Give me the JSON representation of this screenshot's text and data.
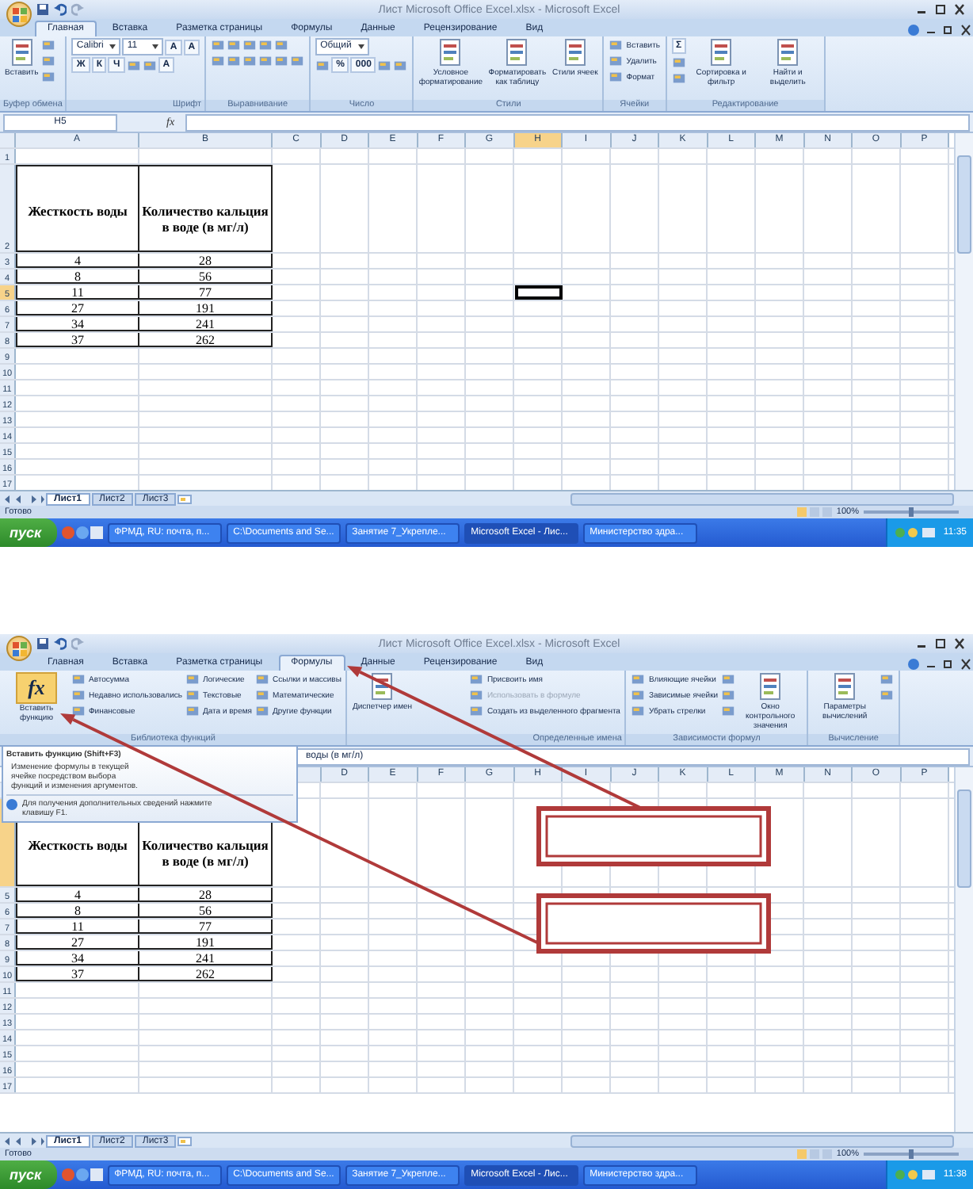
{
  "windows": [
    {
      "title": "Лист Microsoft Office Excel.xlsx - Microsoft Excel",
      "tabs": [
        {
          "label": "Главная",
          "selected": true
        },
        {
          "label": "Вставка",
          "selected": false
        },
        {
          "label": "Разметка страницы",
          "selected": false
        },
        {
          "label": "Формулы",
          "selected": false
        },
        {
          "label": "Данные",
          "selected": false
        },
        {
          "label": "Рецензирование",
          "selected": false
        },
        {
          "label": "Вид",
          "selected": false
        }
      ],
      "ribbon": [
        {
          "label": "Буфер обмена",
          "columns": [
            [
              {
                "kind": "large",
                "label": "Вставить"
              }
            ],
            [
              {
                "kind": "tool"
              },
              {
                "kind": "tool"
              },
              {
                "kind": "tool"
              }
            ]
          ]
        },
        {
          "label": "Шрифт",
          "columns": [
            [
              [
                {
                  "kind": "field",
                  "label": "Calibri"
                },
                {
                  "kind": "field",
                  "label": "11"
                },
                {
                  "kind": "tool",
                  "label": "A"
                },
                {
                  "kind": "tool",
                  "label": "A"
                }
              ],
              [
                {
                  "kind": "tool",
                  "label": "Ж"
                },
                {
                  "kind": "tool",
                  "label": "К"
                },
                {
                  "kind": "tool",
                  "label": "Ч"
                },
                {
                  "kind": "tool"
                },
                {
                  "kind": "tool"
                },
                {
                  "kind": "tool",
                  "label": "A"
                }
              ]
            ]
          ]
        },
        {
          "label": "Выравнивание",
          "columns": [
            [
              [
                {
                  "kind": "tool"
                },
                {
                  "kind": "tool"
                },
                {
                  "kind": "tool"
                },
                {
                  "kind": "tool"
                },
                {
                  "kind": "tool"
                }
              ],
              [
                {
                  "kind": "tool"
                },
                {
                  "kind": "tool"
                },
                {
                  "kind": "tool"
                },
                {
                  "kind": "tool"
                },
                {
                  "kind": "tool"
                },
                {
                  "kind": "tool"
                }
              ]
            ]
          ]
        },
        {
          "label": "Число",
          "columns": [
            [
              [
                {
                  "kind": "field",
                  "label": "Общий"
                }
              ],
              [
                {
                  "kind": "tool"
                },
                {
                  "kind": "tool",
                  "label": "%"
                },
                {
                  "kind": "tool",
                  "label": "000"
                },
                {
                  "kind": "tool"
                },
                {
                  "kind": "tool"
                }
              ]
            ]
          ]
        },
        {
          "label": "Стили",
          "columns": [
            [
              {
                "kind": "large",
                "label": "Условное форматирование"
              }
            ],
            [
              {
                "kind": "large",
                "label": "Форматировать как таблицу"
              }
            ],
            [
              {
                "kind": "large",
                "label": "Стили ячеек"
              }
            ]
          ]
        },
        {
          "label": "Ячейки",
          "columns": [
            [
              {
                "kind": "small",
                "label": "Вставить",
                "disabled": false
              },
              {
                "kind": "small",
                "label": "Удалить",
                "disabled": false
              },
              {
                "kind": "small",
                "label": "Формат",
                "disabled": false
              }
            ]
          ]
        },
        {
          "label": "Редактирование",
          "columns": [
            [
              {
                "kind": "tool",
                "label": "Σ"
              },
              {
                "kind": "tool"
              },
              {
                "kind": "tool"
              }
            ],
            [
              {
                "kind": "large",
                "label": "Сортировка и фильтр"
              }
            ],
            [
              {
                "kind": "large",
                "label": "Найти и выделить"
              }
            ]
          ]
        }
      ],
      "formula_bar": {
        "name_box": "H5",
        "function_button": "fx"
      },
      "grid": {
        "columns": [
          {
            "letter": "A",
            "selected": false
          },
          {
            "letter": "B",
            "selected": false
          },
          {
            "letter": "C",
            "selected": false
          },
          {
            "letter": "D",
            "selected": false
          },
          {
            "letter": "E",
            "selected": false
          },
          {
            "letter": "F",
            "selected": false
          },
          {
            "letter": "G",
            "selected": false
          },
          {
            "letter": "H",
            "selected": true
          },
          {
            "letter": "I",
            "selected": false
          },
          {
            "letter": "J",
            "selected": false
          },
          {
            "letter": "K",
            "selected": false
          },
          {
            "letter": "L",
            "selected": false
          },
          {
            "letter": "M",
            "selected": false
          },
          {
            "letter": "N",
            "selected": false
          },
          {
            "letter": "O",
            "selected": false
          },
          {
            "letter": "P",
            "selected": false
          }
        ],
        "rows": [
          {
            "label": "1",
            "kind": "empty",
            "selected": false
          },
          {
            "label": "2",
            "kind": "header",
            "selected": false,
            "cells": [
              "Жесткость воды",
              "Количество кальция в воде (в мг/л)"
            ]
          },
          {
            "label": "3",
            "kind": "data",
            "selected": false,
            "cells": [
              "4",
              "28"
            ]
          },
          {
            "label": "4",
            "kind": "data",
            "selected": false,
            "cells": [
              "8",
              "56"
            ]
          },
          {
            "label": "5",
            "kind": "data",
            "selected": true,
            "cells": [
              "11",
              "77"
            ]
          },
          {
            "label": "6",
            "kind": "data",
            "selected": false,
            "cells": [
              "27",
              "191"
            ]
          },
          {
            "label": "7",
            "kind": "data",
            "selected": false,
            "cells": [
              "34",
              "241"
            ]
          },
          {
            "label": "8",
            "kind": "data",
            "selected": false,
            "cells": [
              "37",
              "262"
            ]
          },
          {
            "label": "9",
            "kind": "empty",
            "selected": false
          },
          {
            "label": "10",
            "kind": "empty",
            "selected": false
          },
          {
            "label": "11",
            "kind": "empty",
            "selected": false
          },
          {
            "label": "12",
            "kind": "empty",
            "selected": false
          },
          {
            "label": "13",
            "kind": "empty",
            "selected": false
          },
          {
            "label": "14",
            "kind": "empty",
            "selected": false
          },
          {
            "label": "15",
            "kind": "empty",
            "selected": false
          },
          {
            "label": "16",
            "kind": "empty",
            "selected": false
          },
          {
            "label": "17",
            "kind": "empty",
            "selected": false
          }
        ]
      },
      "sheets": [
        {
          "label": "Лист1",
          "selected": true
        },
        {
          "label": "Лист2",
          "selected": false
        },
        {
          "label": "Лист3",
          "selected": false
        }
      ],
      "status": {
        "text": "Готово",
        "zoom": "100%",
        "level": 0.5
      },
      "taskbar": {
        "start": "пуск",
        "items": [
          {
            "label": "ФРМД, RU: почта, п...",
            "selected": false
          },
          {
            "label": "C:\\Documents and Se...",
            "selected": false
          },
          {
            "label": "Занятие 7_Укрепле...",
            "selected": false
          },
          {
            "label": "Microsoft Excel - Лис...",
            "selected": true
          },
          {
            "label": "Министерство здра...",
            "selected": false
          }
        ],
        "clock": "11:35"
      }
    },
    {
      "title": "Лист Microsoft Office Excel.xlsx - Microsoft Excel",
      "tabs": [
        {
          "label": "Главная",
          "selected": false
        },
        {
          "label": "Вставка",
          "selected": false
        },
        {
          "label": "Разметка страницы",
          "selected": false
        },
        {
          "label": "Формулы",
          "selected": true
        },
        {
          "label": "Данные",
          "selected": false
        },
        {
          "label": "Рецензирование",
          "selected": false
        },
        {
          "label": "Вид",
          "selected": false
        }
      ],
      "ribbon": [
        {
          "label": "Библиотека функций",
          "columns": [
            [
              {
                "kind": "large",
                "glyph": "fx",
                "label": "Вставить функцию"
              }
            ],
            [
              {
                "kind": "small",
                "label": "Автосумма",
                "disabled": false
              },
              {
                "kind": "small",
                "label": "Недавно использовались",
                "disabled": false
              },
              {
                "kind": "small",
                "label": "Финансовые",
                "disabled": false
              }
            ],
            [
              {
                "kind": "small",
                "label": "Логические",
                "disabled": false
              },
              {
                "kind": "small",
                "label": "Текстовые",
                "disabled": false
              },
              {
                "kind": "small",
                "label": "Дата и время",
                "disabled": false
              }
            ],
            [
              {
                "kind": "small",
                "label": "Ссылки и массивы",
                "disabled": false
              },
              {
                "kind": "small",
                "label": "Математические",
                "disabled": false
              },
              {
                "kind": "small",
                "label": "Другие функции",
                "disabled": false
              }
            ]
          ]
        },
        {
          "label": "Определенные имена",
          "columns": [
            [
              {
                "kind": "large",
                "label": "Диспетчер имен"
              }
            ],
            [
              {
                "kind": "small",
                "label": "Присвоить имя",
                "disabled": false
              },
              {
                "kind": "small",
                "label": "Использовать в формуле",
                "disabled": true
              },
              {
                "kind": "small",
                "label": "Создать из выделенного фрагмента",
                "disabled": false
              }
            ]
          ]
        },
        {
          "label": "Зависимости формул",
          "columns": [
            [
              {
                "kind": "small",
                "label": "Влияющие ячейки",
                "disabled": false
              },
              {
                "kind": "small",
                "label": "Зависимые ячейки",
                "disabled": false
              },
              {
                "kind": "small",
                "label": "Убрать стрелки",
                "disabled": false
              }
            ],
            [
              {
                "kind": "tool"
              },
              {
                "kind": "tool"
              },
              {
                "kind": "tool"
              }
            ],
            [
              {
                "kind": "large",
                "label": "Окно контрольного значения"
              }
            ]
          ]
        },
        {
          "label": "Вычисление",
          "columns": [
            [
              {
                "kind": "large",
                "label": "Параметры вычислений"
              }
            ],
            [
              {
                "kind": "tool"
              },
              {
                "kind": "tool"
              }
            ]
          ]
        }
      ],
      "formula_bar": {
        "formula": "воды (в мг/л)"
      },
      "tooltip": {
        "title": "Вставить функцию (Shift+F3)",
        "text": "Изменение формулы в текущей ячейке посредством выбора функций и изменения аргументов.",
        "hint": "Для получения дополнительных сведений нажмите клавишу F1."
      },
      "grid": {
        "columns": [
          null,
          null,
          null,
          {
            "letter": "D",
            "selected": false
          },
          {
            "letter": "E",
            "selected": false
          },
          {
            "letter": "F",
            "selected": false
          },
          {
            "letter": "G",
            "selected": false
          },
          {
            "letter": "H",
            "selected": false
          },
          {
            "letter": "I",
            "selected": false
          },
          {
            "letter": "J",
            "selected": false
          },
          {
            "letter": "K",
            "selected": false
          },
          {
            "letter": "L",
            "selected": false
          },
          {
            "letter": "M",
            "selected": false
          },
          {
            "letter": "N",
            "selected": false
          },
          {
            "letter": "O",
            "selected": false
          },
          {
            "letter": "P",
            "selected": false
          }
        ],
        "rows": [
          {
            "kind": "empty",
            "selected": false
          },
          {
            "kind": "header",
            "selected": true,
            "cells": [
              "Жесткость воды",
              "Количество кальция в воде (в мг/л)"
            ]
          },
          {
            "label": "5",
            "kind": "data",
            "selected": false,
            "cells": [
              "4",
              "28"
            ]
          },
          {
            "label": "6",
            "kind": "data",
            "selected": false,
            "cells": [
              "8",
              "56"
            ]
          },
          {
            "label": "7",
            "kind": "data",
            "selected": false,
            "cells": [
              "11",
              "77"
            ]
          },
          {
            "label": "8",
            "kind": "data",
            "selected": false,
            "cells": [
              "27",
              "191"
            ]
          },
          {
            "label": "9",
            "kind": "data",
            "selected": false,
            "cells": [
              "34",
              "241"
            ]
          },
          {
            "label": "10",
            "kind": "data",
            "selected": false,
            "cells": [
              "37",
              "262"
            ]
          },
          {
            "label": "11",
            "kind": "empty",
            "selected": false
          },
          {
            "label": "12",
            "kind": "empty",
            "selected": false
          },
          {
            "label": "13",
            "kind": "empty",
            "selected": false
          },
          {
            "label": "14",
            "kind": "empty",
            "selected": false
          },
          {
            "label": "15",
            "kind": "empty",
            "selected": false
          },
          {
            "label": "16",
            "kind": "empty",
            "selected": false
          },
          {
            "label": "17",
            "kind": "empty",
            "selected": false
          }
        ]
      },
      "sheets": [
        {
          "label": "Лист1",
          "selected": true
        },
        {
          "label": "Лист2",
          "selected": false
        },
        {
          "label": "Лист3",
          "selected": false
        }
      ],
      "status": {
        "text": "Готово",
        "zoom": "100%",
        "level": 0.5
      },
      "taskbar": {
        "start": "пуск",
        "items": [
          {
            "label": "ФРМД, RU: почта, п...",
            "selected": false
          },
          {
            "label": "C:\\Documents and Se...",
            "selected": false
          },
          {
            "label": "Занятие 7_Укрепле...",
            "selected": false
          },
          {
            "label": "Microsoft Excel - Лис...",
            "selected": true
          },
          {
            "label": "Министерство здра...",
            "selected": false
          }
        ],
        "clock": "11:38"
      },
      "annotated": true
    }
  ]
}
